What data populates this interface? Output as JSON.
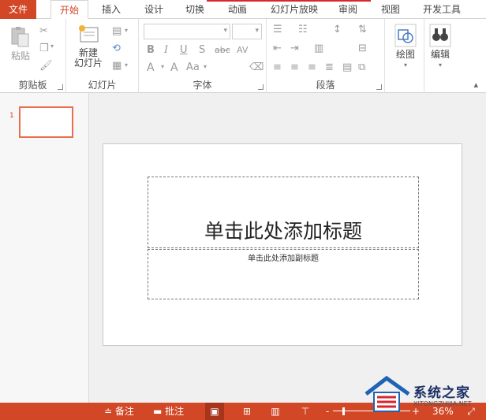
{
  "tabs": [
    {
      "label": "文件"
    },
    {
      "label": "开始"
    },
    {
      "label": "插入"
    },
    {
      "label": "设计"
    },
    {
      "label": "切换"
    },
    {
      "label": "动画"
    },
    {
      "label": "幻灯片放映"
    },
    {
      "label": "审阅"
    },
    {
      "label": "视图"
    },
    {
      "label": "开发工具"
    }
  ],
  "ribbon": {
    "clipboard": {
      "label": "剪贴板",
      "paste_label": "粘贴"
    },
    "slides": {
      "label": "幻灯片",
      "new_slide_line1": "新建",
      "new_slide_line2": "幻灯片"
    },
    "font": {
      "label": "字体",
      "bold": "B",
      "italic": "I",
      "underline": "U",
      "shadow": "S",
      "strike": "abc",
      "spacing": "AV",
      "font_color": "A",
      "font_size_up": "A",
      "change_case": "Aa"
    },
    "paragraph": {
      "label": "段落"
    },
    "drawing": {
      "label": "绘图"
    },
    "editing": {
      "label": "编辑"
    }
  },
  "thumbnail": {
    "number": "1"
  },
  "slide": {
    "title_placeholder": "单击此处添加标题",
    "subtitle_placeholder": "单击此处添加副标题"
  },
  "statusbar": {
    "notes_label": "备注",
    "comments_label": "批注",
    "zoom_minus": "-",
    "zoom_plus": "+",
    "zoom_level": "36%"
  },
  "watermark": {
    "name": "系统之家",
    "url": "XITONGZHIJIA.NET"
  },
  "colors": {
    "accent": "#d24726",
    "statusbar": "#d24726",
    "thumb_border": "#e8704e"
  }
}
